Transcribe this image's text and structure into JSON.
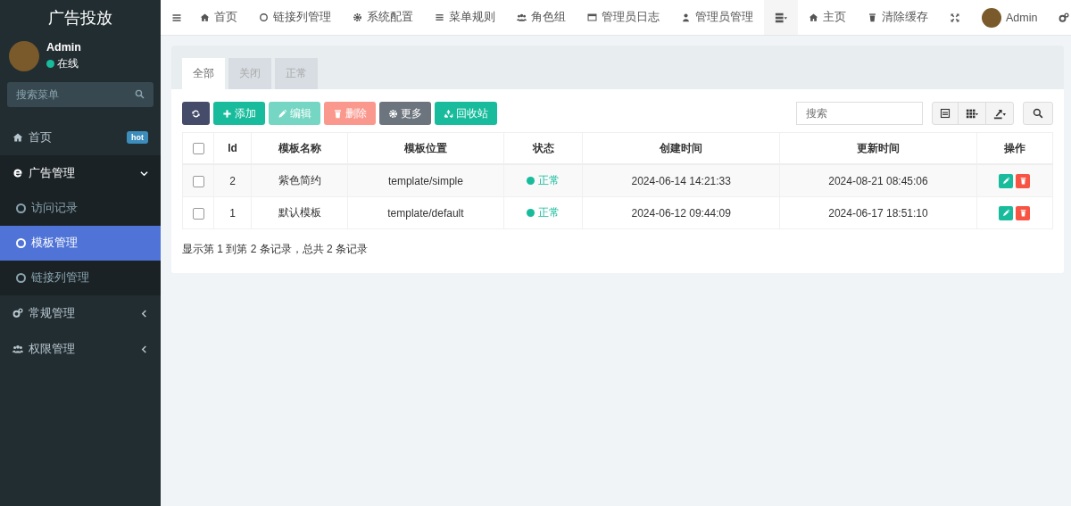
{
  "sidebar": {
    "title": "广告投放",
    "user": {
      "name": "Admin",
      "status": "在线",
      "color": "#18bc9c"
    },
    "search": {
      "placeholder": "搜索菜单"
    },
    "menu": [
      {
        "label": "首页",
        "badge": "hot",
        "expanded": false
      },
      {
        "label": "广告管理",
        "expanded": true,
        "children": [
          {
            "label": "访问记录",
            "selected": false
          },
          {
            "label": "模板管理",
            "selected": true
          },
          {
            "label": "链接列管理",
            "selected": false
          }
        ]
      },
      {
        "label": "常规管理",
        "expanded": false
      },
      {
        "label": "权限管理",
        "expanded": false
      }
    ]
  },
  "topbar": {
    "nav": [
      {
        "label": "首页"
      },
      {
        "label": "链接列管理"
      },
      {
        "label": "系统配置"
      },
      {
        "label": "菜单规则"
      },
      {
        "label": "角色组"
      },
      {
        "label": "管理员日志"
      },
      {
        "label": "管理员管理"
      }
    ],
    "right": [
      {
        "label": "主页"
      },
      {
        "label": "清除缓存"
      }
    ],
    "user": "Admin"
  },
  "tabs": [
    {
      "label": "全部",
      "selected": true
    },
    {
      "label": "关闭",
      "selected": false
    },
    {
      "label": "正常",
      "selected": false
    }
  ],
  "toolbar": [
    {
      "kind": "refresh",
      "disabled": false
    },
    {
      "kind": "add",
      "label": "添加",
      "disabled": false
    },
    {
      "kind": "edit",
      "label": "编辑",
      "disabled": true
    },
    {
      "kind": "delete",
      "label": "删除",
      "disabled": true
    },
    {
      "kind": "more",
      "label": "更多",
      "disabled": false
    },
    {
      "kind": "recycle",
      "label": "回收站",
      "disabled": false
    }
  ],
  "table_search": {
    "placeholder": "搜索"
  },
  "table": {
    "select_all_checked": false,
    "columns": [
      "Id",
      "模板名称",
      "模板位置",
      "状态",
      "创建时间",
      "更新时间",
      "操作"
    ],
    "rows": [
      {
        "checked": false,
        "id": "2",
        "name": "紫色简约",
        "path": "template/simple",
        "status": "正常",
        "color": "#18bc9c",
        "created": "2024-06-14 14:21:33",
        "updated": "2024-08-21 08:45:06"
      },
      {
        "checked": false,
        "id": "1",
        "name": "默认模板",
        "path": "template/default",
        "status": "正常",
        "color": "#18bc9c",
        "created": "2024-06-12 09:44:09",
        "updated": "2024-06-17 18:51:10"
      }
    ]
  },
  "footer": "显示第 1 到第 2 条记录，总共 2 条记录"
}
